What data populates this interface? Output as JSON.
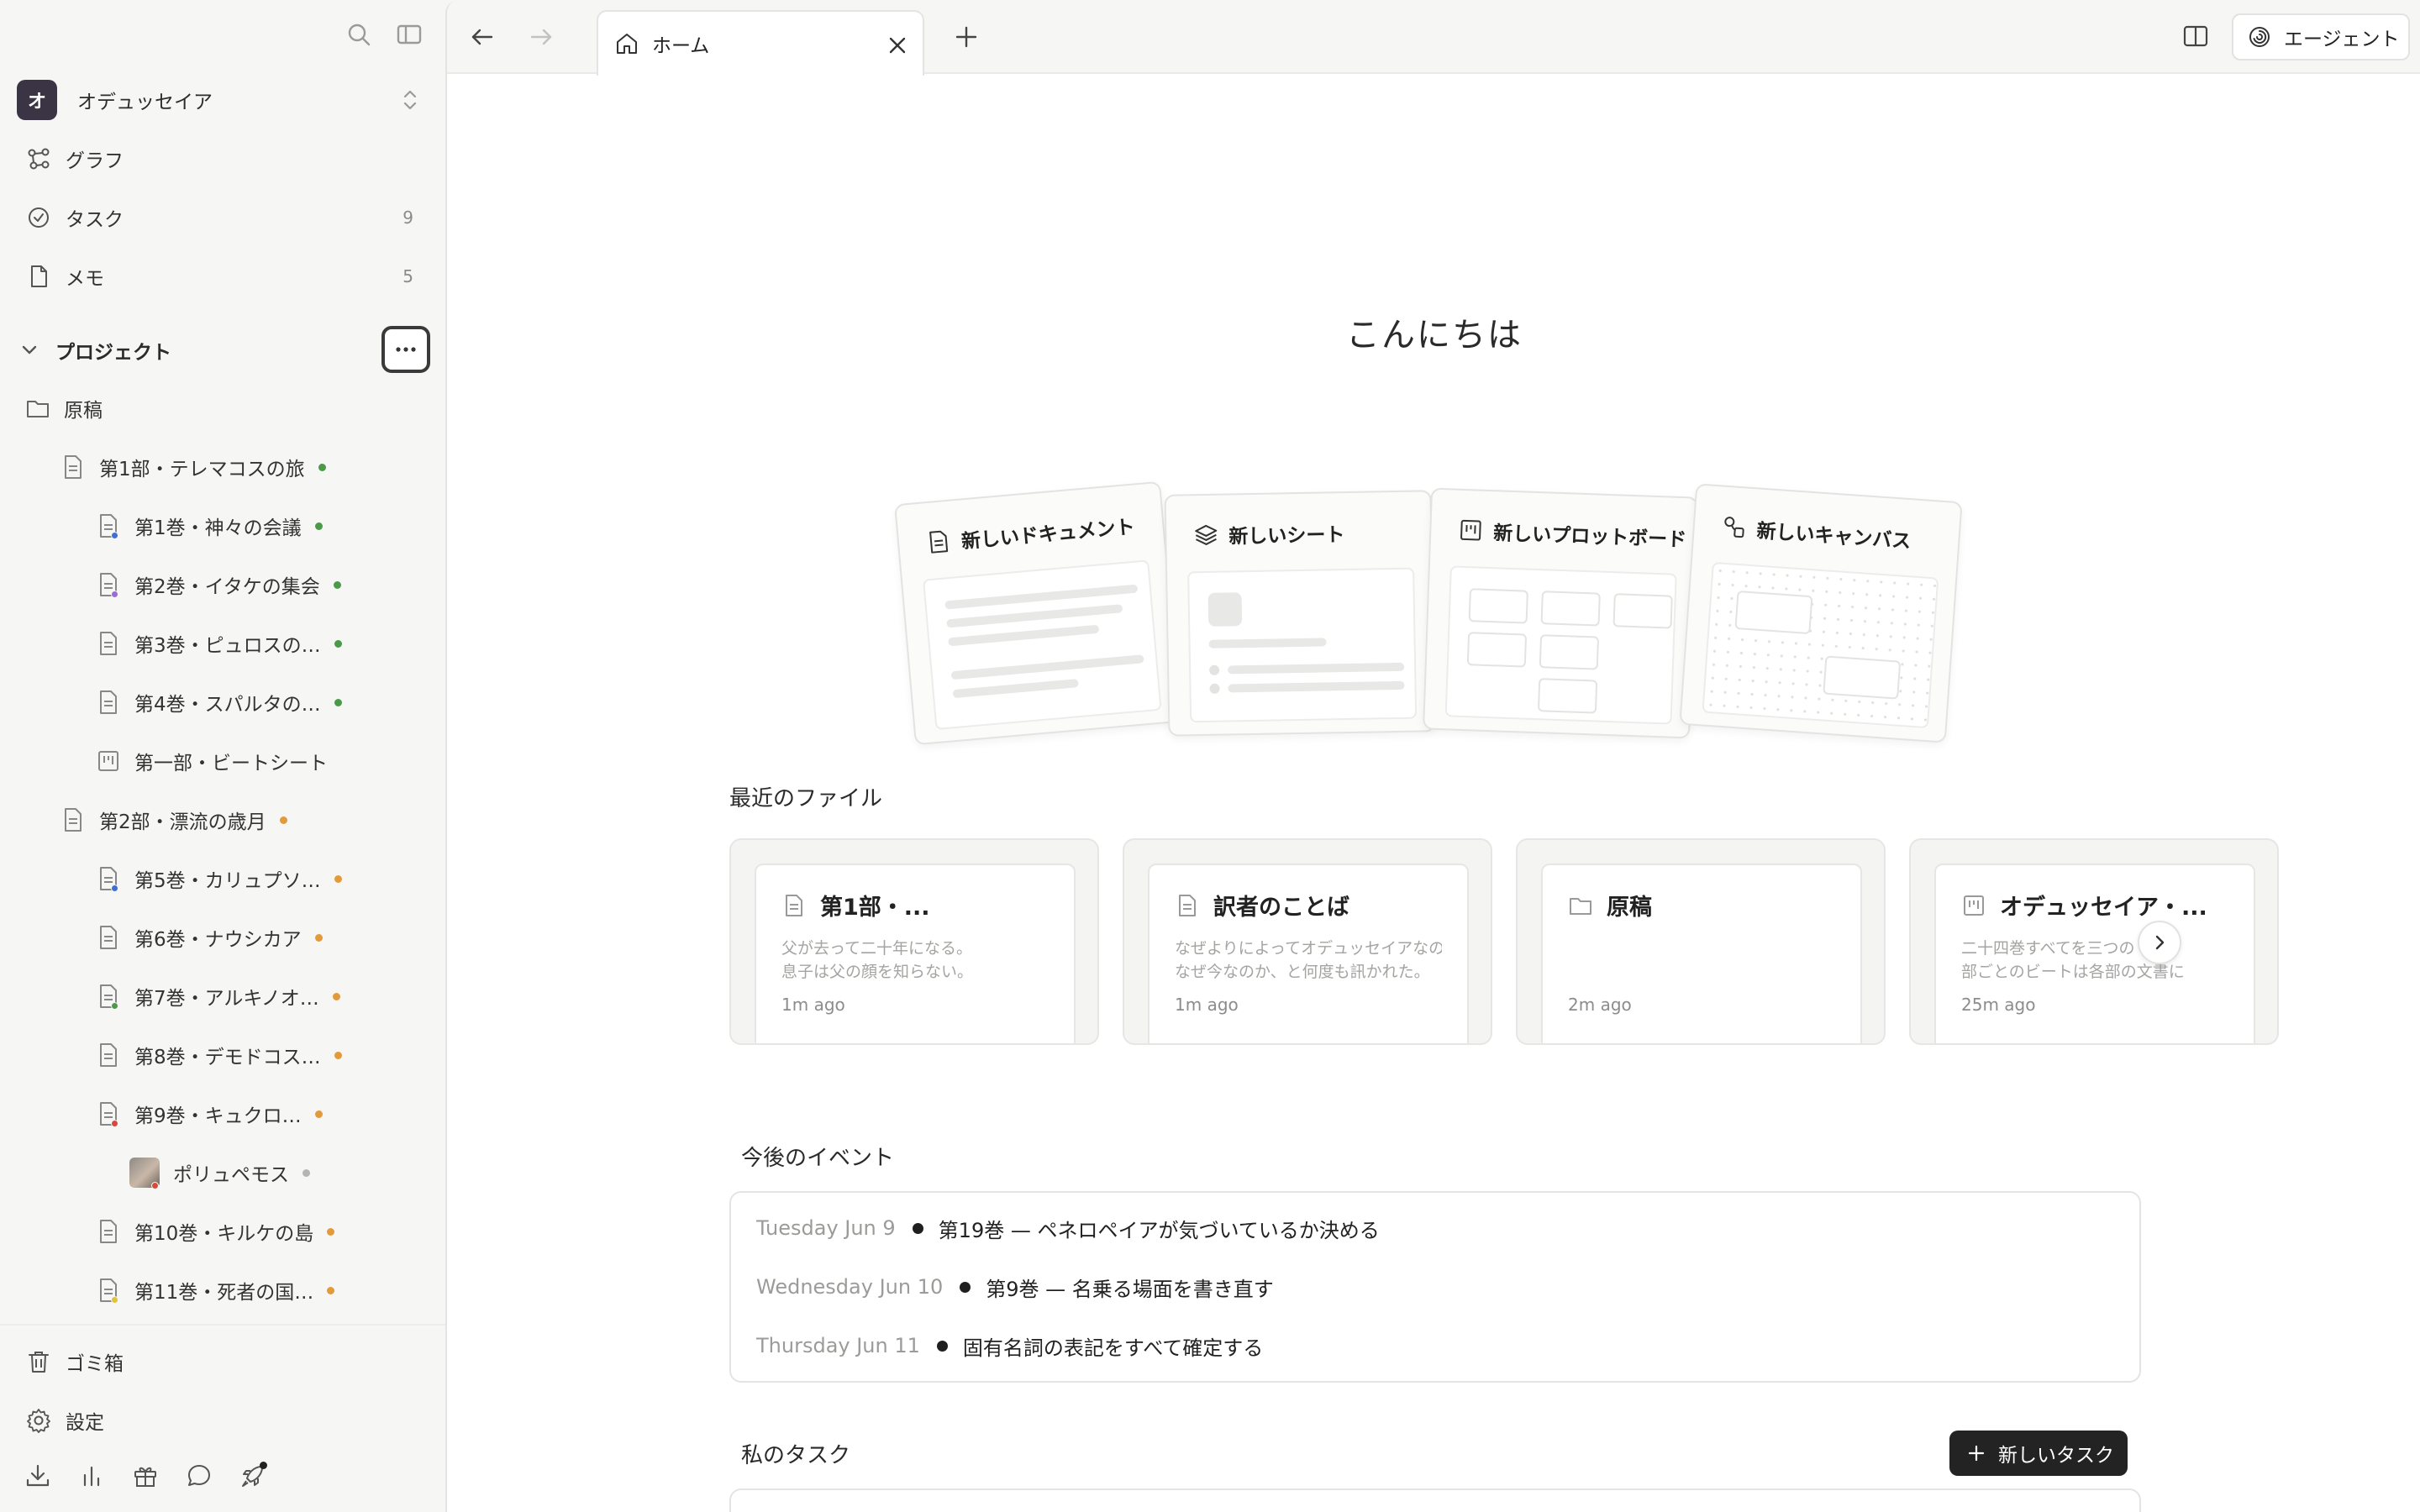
{
  "workspace": {
    "initial": "オ",
    "name": "オデュッセイア"
  },
  "nav": [
    {
      "label": "グラフ",
      "icon": "graph-icon",
      "count": ""
    },
    {
      "label": "タスク",
      "icon": "task-check-icon",
      "count": "9"
    },
    {
      "label": "メモ",
      "icon": "note-icon",
      "count": "5"
    }
  ],
  "projects": {
    "heading": "プロジェクト",
    "tree": [
      {
        "label": "原稿",
        "icon": "folder-icon",
        "dot": ""
      },
      {
        "label": "第1部・テレマコスの旅",
        "icon": "document-icon",
        "dot": "#4a9a4a"
      },
      {
        "label": "第1巻・神々の会議",
        "icon": "document-icon",
        "dot": "#4a9a4a",
        "subdot": "#3d6fd6"
      },
      {
        "label": "第2巻・イタケの集会",
        "icon": "document-icon",
        "dot": "#4a9a4a",
        "subdot": "#9a6ad6"
      },
      {
        "label": "第3巻・ピュロスの…",
        "icon": "document-icon",
        "dot": "#4a9a4a"
      },
      {
        "label": "第4巻・スパルタの…",
        "icon": "document-icon",
        "dot": "#4a9a4a"
      },
      {
        "label": "第一部・ビートシート",
        "icon": "board-icon",
        "dot": ""
      },
      {
        "label": "第2部・漂流の歳月",
        "icon": "document-icon",
        "dot": "#e39a3a"
      },
      {
        "label": "第5巻・カリュプソ…",
        "icon": "document-icon",
        "dot": "#e39a3a",
        "subdot": "#3d6fd6"
      },
      {
        "label": "第6巻・ナウシカア",
        "icon": "document-icon",
        "dot": "#e39a3a"
      },
      {
        "label": "第7巻・アルキノオ…",
        "icon": "document-icon",
        "dot": "#e39a3a",
        "subdot": "#4a9a4a"
      },
      {
        "label": "第8巻・デモドコス…",
        "icon": "document-icon",
        "dot": "#e39a3a"
      },
      {
        "label": "第9巻・キュクロ…",
        "icon": "document-icon",
        "dot": "#e39a3a",
        "subdot": "#d64a3d"
      },
      {
        "label": "ポリュペモス",
        "icon": "image-thumbnail",
        "dot": "#b5b5b3",
        "subdot": "#d64a3d"
      },
      {
        "label": "第10巻・キルケの島",
        "icon": "document-icon",
        "dot": "#e39a3a"
      },
      {
        "label": "第11巻・死者の国…",
        "icon": "document-icon",
        "dot": "#e39a3a",
        "subdot": "#e3c23a"
      }
    ]
  },
  "bottom_nav": [
    {
      "label": "ゴミ箱",
      "icon": "trash-icon"
    },
    {
      "label": "設定",
      "icon": "gear-icon"
    }
  ],
  "tools": [
    "download-icon",
    "chart-icon",
    "gift-icon",
    "chat-icon",
    "rocket-icon"
  ],
  "tab": {
    "label": "ホーム",
    "icon": "home-icon"
  },
  "agent_button": "エージェント",
  "greeting": "こんにちは",
  "create_cards": [
    {
      "label": "新しいドキュメント",
      "icon": "document-icon"
    },
    {
      "label": "新しいシート",
      "icon": "layers-icon"
    },
    {
      "label": "新しいプロットボード",
      "icon": "board-icon"
    },
    {
      "label": "新しいキャンバス",
      "icon": "canvas-icon"
    }
  ],
  "recent": {
    "title": "最近のファイル",
    "files": [
      {
        "title": "第1部・...",
        "icon": "document-icon",
        "line1": "父が去って二十年になる。",
        "line2": "息子は父の顔を知らない。",
        "time": "1m ago"
      },
      {
        "title": "訳者のことば",
        "icon": "document-icon",
        "line1": "なぜよりによってオデュッセイアなのか",
        "line2": "なぜ今なのか、と何度も訊かれた。",
        "time": "1m ago"
      },
      {
        "title": "原稿",
        "icon": "folder-icon",
        "line1": "",
        "line2": "",
        "time": "2m ago"
      },
      {
        "title": "オデュッセイア・...",
        "icon": "board-icon",
        "line1": "二十四巻すべてを三つの",
        "line2": "部ごとのビートは各部の文書に",
        "time": "25m ago"
      }
    ]
  },
  "events": {
    "title": "今後のイベント",
    "items": [
      {
        "date": "Tuesday Jun 9",
        "text": "第19巻 — ペネロペイアが気づいているか決める"
      },
      {
        "date": "Wednesday Jun 10",
        "text": "第9巻 — 名乗る場面を書き直す"
      },
      {
        "date": "Thursday Jun 11",
        "text": "固有名詞の表記をすべて確定する"
      }
    ]
  },
  "tasks": {
    "title": "私のタスク",
    "new_task_label": "新しいタスク"
  }
}
